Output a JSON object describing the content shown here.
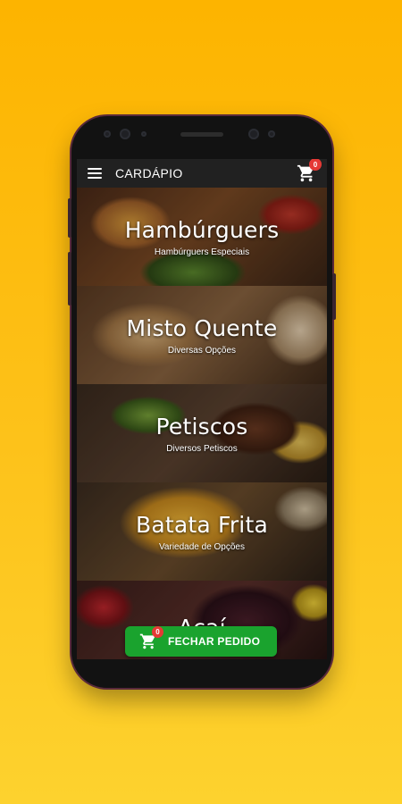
{
  "app_bar": {
    "title": "CARDÁPIO",
    "menu_icon": "menu-icon",
    "cart_icon": "cart-icon",
    "cart_badge": "0"
  },
  "menu": {
    "categories": [
      {
        "name": "Hambúrguers",
        "subtitle": "Hambúrguers Especiais"
      },
      {
        "name": "Misto Quente",
        "subtitle": "Diversas Opções"
      },
      {
        "name": "Petiscos",
        "subtitle": "Diversos Petiscos"
      },
      {
        "name": "Batata Frita",
        "subtitle": "Variedade de Opções"
      },
      {
        "name": "Açaí",
        "subtitle": ""
      }
    ]
  },
  "fab": {
    "label": "FECHAR PEDIDO",
    "badge": "0",
    "color": "#1AA32E"
  },
  "colors": {
    "background": "#FDB400",
    "app_bar": "#212121",
    "badge": "#E53935"
  }
}
